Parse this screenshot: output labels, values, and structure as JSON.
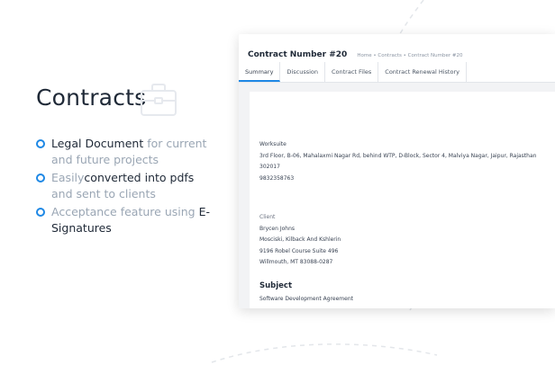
{
  "heading": "Contracts",
  "features": [
    {
      "parts": [
        {
          "text": "Legal Document",
          "tone": "dark"
        },
        {
          "text": " for current and future projects",
          "tone": "light"
        }
      ]
    },
    {
      "parts": [
        {
          "text": "Easily",
          "tone": "light"
        },
        {
          "text": "converted into pdfs",
          "tone": "dark"
        },
        {
          "text": " and sent to clients",
          "tone": "light"
        }
      ]
    },
    {
      "parts": [
        {
          "text": "Acceptance feature using ",
          "tone": "light"
        },
        {
          "text": "E-Signatures",
          "tone": "dark"
        }
      ]
    }
  ],
  "card": {
    "title": "Contract Number #20",
    "breadcrumb": "Home • Contracts • Contract Number #20",
    "tabs": [
      "Summary",
      "Discussion",
      "Contract Files",
      "Contract Renewal History"
    ],
    "active_tab": 0,
    "worksuite": {
      "label": "Worksuite",
      "address_line1": "3rd Floor, B-06, Mahalaxmi Nagar Rd, behind WTP, D-Block, Sector 4, Malviya Nagar, Jaipur, Rajasthan",
      "address_line2": "302017",
      "phone": "9832358763"
    },
    "client": {
      "label": "Client",
      "name": "Brycen Johns",
      "company": "Mosciski, Kilback And Kshlerin",
      "street": "9196 Robel Course Suite 496",
      "city": "Willmouth, MT 83088-0287"
    },
    "subject": {
      "label": "Subject",
      "value": "Software Development Agreement"
    }
  },
  "colors": {
    "accent": "#1e88e5",
    "heading": "#1f2937",
    "muted": "#9aa6b4"
  },
  "icons": {
    "heading_decoration": "briefcase-icon",
    "bullet": "circle-bullet-icon"
  }
}
